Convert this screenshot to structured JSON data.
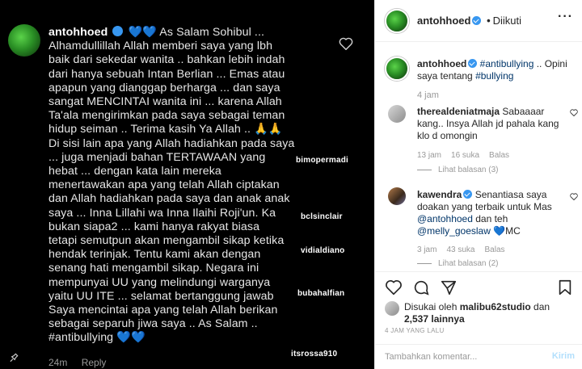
{
  "post_image": {
    "username": "antohhoed",
    "caption_lines": [
      "As Salam Sohibul ...",
      "Alhamdullillah Allah memberi saya yang lbh",
      "baik dari sekedar wanita .. bahkan lebih indah",
      "dari hanya sebuah Intan Berlian ... Emas atau",
      "apapun yang dianggap berharga ... dan saya",
      "sangat MENCINTAI wanita ini ... karena Allah",
      "Ta'ala mengirimkan pada saya sebagai teman",
      "hidup seiman .. Terima kasih Ya Allah .. 🙏🙏",
      "Di sisi lain apa yang Allah hadiahkan pada saya",
      "... juga menjadi bahan TERTAWAAN yang",
      "hebat ... dengan kata lain mereka",
      "menertawakan apa yang telah Allah ciptakan",
      "dan Allah hadiahkan pada saya dan anak anak",
      "saya ... Inna Lillahi wa Inna Ilaihi Roji'un. Ka",
      "bukan siapa2 ... kami hanya rakyat biasa",
      "tetapi semutpun akan mengambil sikap ketika",
      "hendak terinjak. Tentu kami akan dengan",
      "senang hati mengambil sikap. Negara ini",
      "mempunyai UU yang melindungi warganya",
      "yaitu UU ITE ... selamat bertanggung jawab",
      "Saya mencintai apa yang telah Allah berikan",
      "sebagai separuh jiwa saya .. As Salam ..",
      "#antibullying 💙💙"
    ],
    "blue_hearts": "💙💙",
    "time": "24m",
    "reply": "Reply",
    "tags": [
      "bimopermadi",
      "bclsinclair",
      "vidialdiano",
      "bubahalfian",
      "itsrossa910"
    ]
  },
  "header": {
    "username": "antohhoed",
    "dot": "•",
    "follow_status": "Diikuti",
    "more": "···"
  },
  "caption": {
    "username": "antohhoed",
    "hashtag": "#antibullying",
    "text": " .. Opini saya tentang ",
    "hashtag2": "#bullying",
    "time": "4 jam"
  },
  "comments": [
    {
      "username": "therealdeniatmaja",
      "text": " Sabaaaar kang.. Insya Allah jd pahala kang klo d omongin",
      "time": "13 jam",
      "likes": "16 suka",
      "reply": "Balas",
      "see_replies": "Lihat balasan (3)"
    },
    {
      "username": "kawendra",
      "text": " Senantiasa saya doakan yang terbaik untuk Mas ",
      "mention1": "@antohhoed",
      "text2": " dan teh ",
      "mention2": "@melly_goeslaw",
      "tail": "💙MC",
      "time": "3 jam",
      "likes": "43 suka",
      "reply": "Balas",
      "see_replies": "Lihat balasan (2)"
    }
  ],
  "likes": {
    "prefix": "Disukai oleh ",
    "user": "malibu62studio",
    "mid": " dan",
    "count": "2,537 lainnya"
  },
  "post_time": "4 JAM YANG LALU",
  "add_comment": {
    "placeholder": "Tambahkan komentar...",
    "post_label": "Kirim"
  },
  "colors": {
    "link": "#003569",
    "verified": "#3897f0",
    "post_button": "#b2dffc"
  }
}
